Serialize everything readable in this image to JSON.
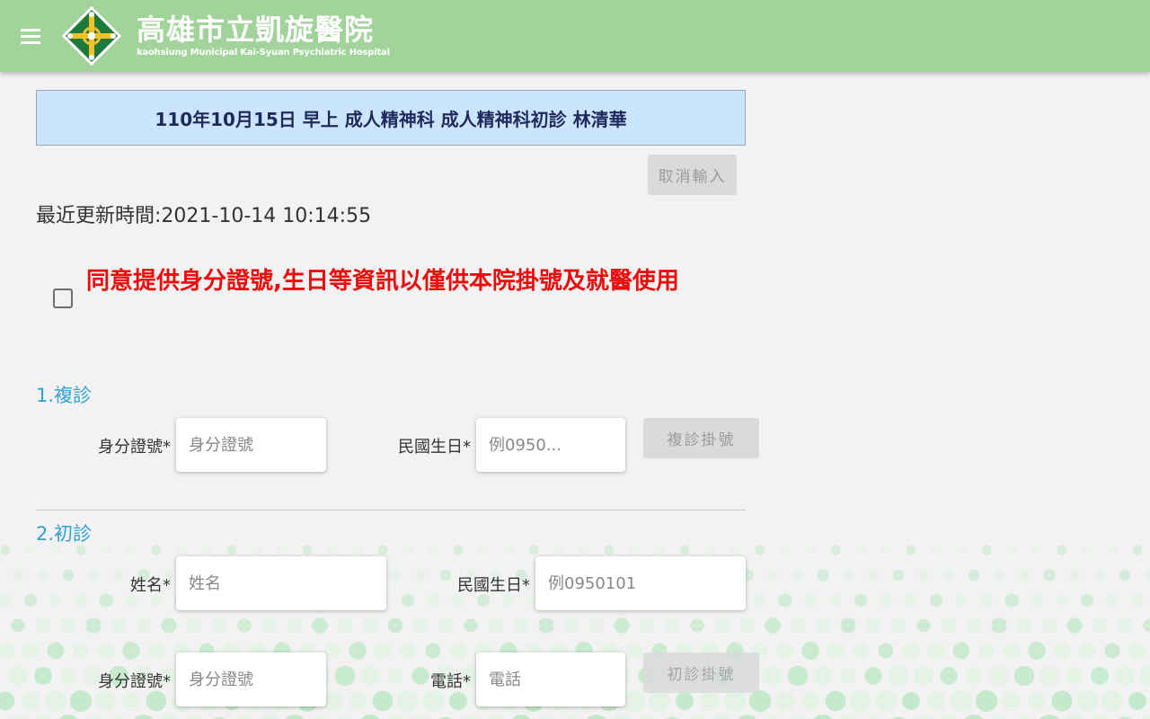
{
  "header": {
    "hospital_name": "高雄市立凱旋醫院",
    "hospital_subtitle": "kaohsiung Municipal Kai-Syuan Psychiatric Hospital",
    "menu_icon": "hamburger-menu-icon",
    "logo_icon": "hospital-logo-icon",
    "bg_color": "#a1d39b"
  },
  "banner": {
    "text": "110年10月15日 早上 成人精神科 成人精神科初診 林清華",
    "bg_color": "#cce5ff"
  },
  "cancel_button": {
    "label": "取消輸入"
  },
  "last_updated": "最近更新時間:2021-10-14 10:14:55",
  "consent": {
    "checked": false,
    "text": "同意提供身分證號,生日等資訊以僅供本院掛號及就醫使用",
    "color": "#ec0b0b"
  },
  "revisit": {
    "title": "1.複診",
    "id_label": "身分證號*",
    "id_placeholder": "身分證號",
    "birthday_label": "民國生日*",
    "birthday_placeholder": "例0950...",
    "submit_label": "複診掛號"
  },
  "first_visit": {
    "title": "2.初診",
    "name_label": "姓名*",
    "name_placeholder": "姓名",
    "birthday_label": "民國生日*",
    "birthday_placeholder": "例0950101",
    "id_label": "身分證號*",
    "id_placeholder": "身分證號",
    "phone_label": "電話*",
    "phone_placeholder": "電話",
    "submit_label": "初診掛號"
  },
  "accent_color": "#31a1d6"
}
